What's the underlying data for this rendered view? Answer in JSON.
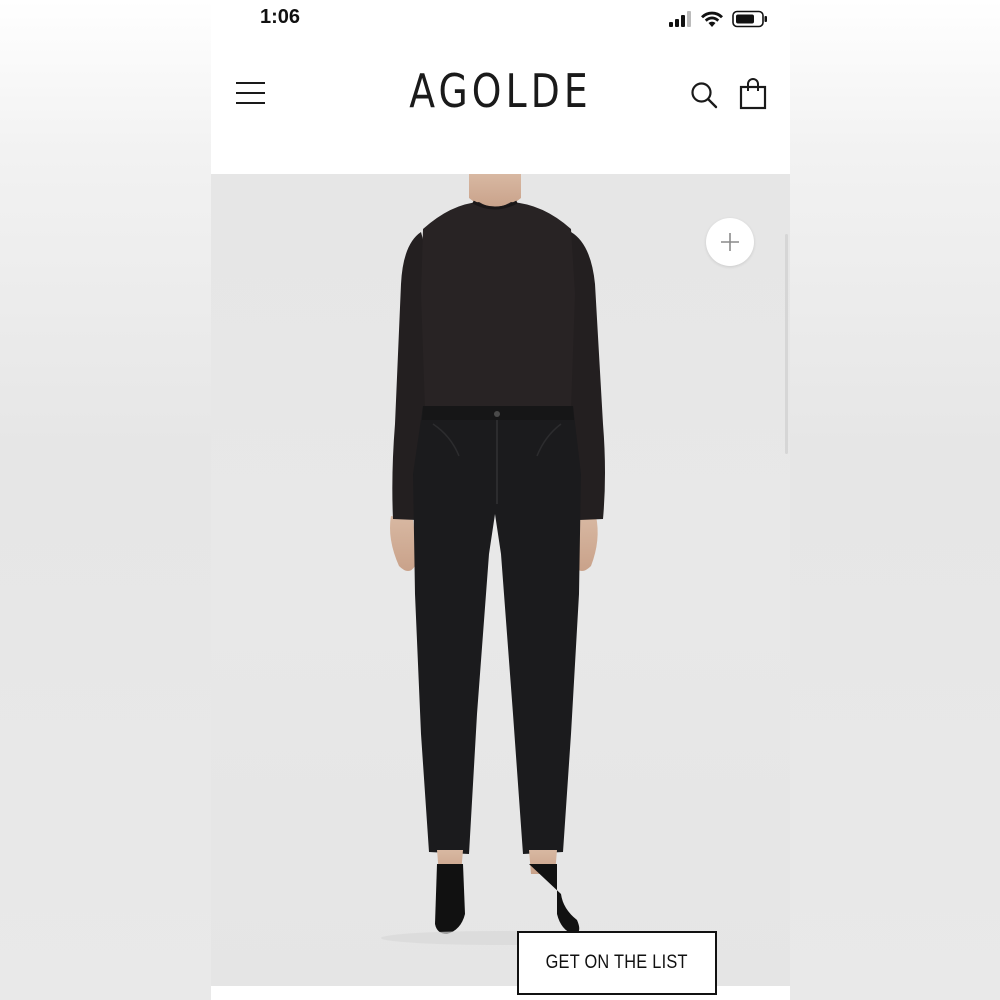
{
  "status_bar": {
    "time": "1:06"
  },
  "header": {
    "brand": "AGOLDE",
    "menu_icon": "hamburger-menu-icon",
    "search_icon": "search-icon",
    "cart_icon": "shopping-bag-icon"
  },
  "product_gallery": {
    "zoom_icon": "plus-icon"
  },
  "cta": {
    "label": "GET ON THE LIST"
  },
  "colors": {
    "text": "#1a1a1a",
    "background": "#ffffff",
    "image_background": "#e6e6e6",
    "garment": "#1e1b1c"
  }
}
